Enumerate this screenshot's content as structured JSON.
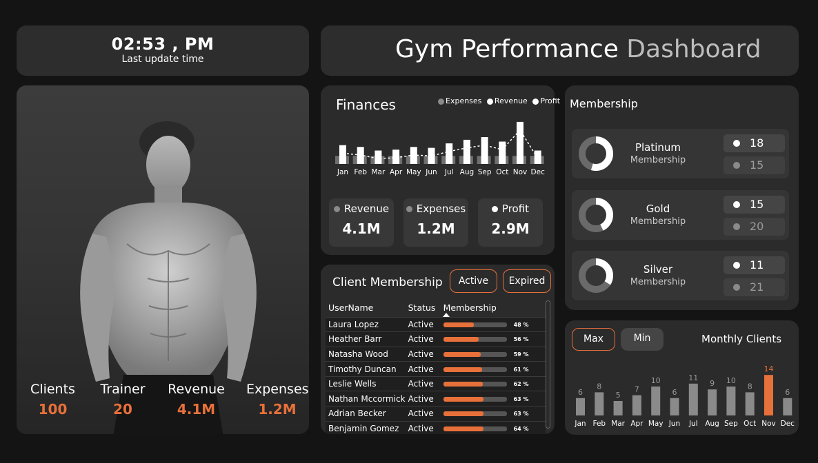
{
  "header": {
    "time": "02:53 , PM",
    "time_label": "Last update time",
    "title_bold": "Gym Performance",
    "title_light": "Dashboard"
  },
  "hero": {
    "kpis": [
      {
        "label": "Clients",
        "value": "100"
      },
      {
        "label": "Trainer",
        "value": "20"
      },
      {
        "label": "Revenue",
        "value": "4.1M"
      },
      {
        "label": "Expenses",
        "value": "1.2M"
      }
    ]
  },
  "finances": {
    "title": "Finances",
    "legend": [
      "Expenses",
      "Revenue",
      "Profit"
    ],
    "kpis": [
      {
        "label": "Revenue",
        "value": "4.1M",
        "dot_color": "#8a8a8a"
      },
      {
        "label": "Expenses",
        "value": "1.2M",
        "dot_color": "#8a8a8a"
      },
      {
        "label": "Profit",
        "value": "2.9M",
        "dot_color": "#ffffff"
      }
    ]
  },
  "client_membership": {
    "title": "Client Membership",
    "filters": [
      "Active",
      "Expired"
    ],
    "columns": [
      "UserName",
      "Status",
      "Membership"
    ],
    "rows": [
      {
        "name": "Laura Lopez",
        "status": "Active",
        "pct": "48 %",
        "value": 48
      },
      {
        "name": "Heather Barr",
        "status": "Active",
        "pct": "56 %",
        "value": 56
      },
      {
        "name": "Natasha Wood",
        "status": "Active",
        "pct": "59 %",
        "value": 59
      },
      {
        "name": "Timothy Duncan",
        "status": "Active",
        "pct": "61 %",
        "value": 61
      },
      {
        "name": "Leslie Wells",
        "status": "Active",
        "pct": "62 %",
        "value": 62
      },
      {
        "name": "Nathan Mccormick",
        "status": "Active",
        "pct": "63 %",
        "value": 63
      },
      {
        "name": "Adrian Becker",
        "status": "Active",
        "pct": "63 %",
        "value": 63
      },
      {
        "name": "Benjamin Gomez",
        "status": "Active",
        "pct": "64 %",
        "value": 64
      }
    ]
  },
  "membership": {
    "title": "Membership",
    "tiers": [
      {
        "name": "Platinum",
        "sub": "Membership",
        "active": "18",
        "expired": "15",
        "share": 0.545
      },
      {
        "name": "Gold",
        "sub": "Membership",
        "active": "15",
        "expired": "20",
        "share": 0.43
      },
      {
        "name": "Silver",
        "sub": "Membership",
        "active": "11",
        "expired": "21",
        "share": 0.34
      }
    ]
  },
  "monthly_clients": {
    "title": "Monthly Clients",
    "buttons": [
      "Max",
      "Min"
    ]
  },
  "chart_data": [
    {
      "type": "bar",
      "title": "Finances",
      "categories": [
        "Jan",
        "Feb",
        "Mar",
        "Apr",
        "May",
        "Jun",
        "Jul",
        "Aug",
        "Sep",
        "Oct",
        "Nov",
        "Dec"
      ],
      "series": [
        {
          "name": "Expenses",
          "values": [
            0.09,
            0.09,
            0.09,
            0.09,
            0.09,
            0.09,
            0.09,
            0.09,
            0.09,
            0.09,
            0.09,
            0.09
          ]
        },
        {
          "name": "Revenue",
          "values": [
            0.21,
            0.19,
            0.15,
            0.16,
            0.19,
            0.18,
            0.23,
            0.27,
            0.3,
            0.25,
            0.47,
            0.15
          ]
        },
        {
          "name": "Profit",
          "values": [
            0.12,
            0.1,
            0.06,
            0.07,
            0.1,
            0.09,
            0.14,
            0.18,
            0.21,
            0.16,
            0.38,
            0.06
          ]
        }
      ]
    },
    {
      "type": "bar",
      "title": "Monthly Clients",
      "categories": [
        "Jan",
        "Feb",
        "Mar",
        "Apr",
        "May",
        "Jun",
        "Jul",
        "Aug",
        "Sep",
        "Oct",
        "Nov",
        "Dec"
      ],
      "values": [
        6,
        8,
        5,
        7,
        10,
        6,
        11,
        9,
        10,
        8,
        14,
        6
      ],
      "highlight_color": "#e8703a",
      "bar_color": "#8a8a8a"
    }
  ]
}
